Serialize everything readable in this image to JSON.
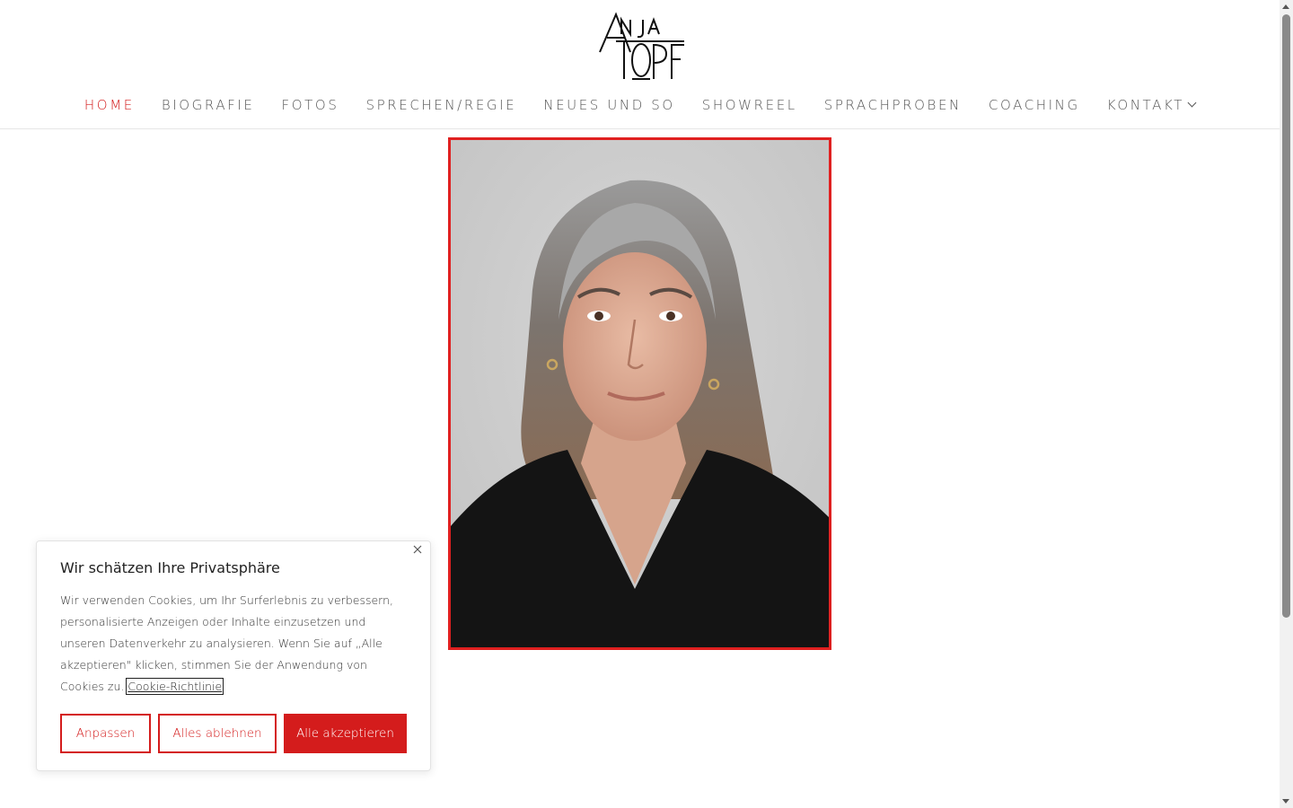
{
  "brand": {
    "logo_text_top": "ANJA",
    "logo_text_bottom": "TOPF",
    "accent_color": "#d41c1c"
  },
  "nav": {
    "items": [
      {
        "label": "HOME",
        "active": true
      },
      {
        "label": "BIOGRAFIE",
        "active": false
      },
      {
        "label": "FOTOS",
        "active": false
      },
      {
        "label": "SPRECHEN/REGIE",
        "active": false
      },
      {
        "label": "NEUES UND SO",
        "active": false
      },
      {
        "label": "SHOWREEL",
        "active": false
      },
      {
        "label": "SPRACHPROBEN",
        "active": false
      },
      {
        "label": "COACHING",
        "active": false
      },
      {
        "label": "KONTAKT",
        "active": false,
        "has_dropdown": true
      }
    ]
  },
  "cookie": {
    "title": "Wir schätzen Ihre Privatsphäre",
    "text": "Wir verwenden Cookies, um Ihr Surferlebnis zu verbessern, personalisierte Anzeigen oder Inhalte einzusetzen und unseren Datenverkehr zu analysieren. Wenn Sie auf „Alle akzeptieren\" klicken, stimmen Sie der Anwendung von Cookies zu.",
    "link_label": "Cookie-Richtlinie",
    "buttons": {
      "customize": "Anpassen",
      "reject": "Alles ablehnen",
      "accept": "Alle akzeptieren"
    },
    "close_icon": "close-icon"
  }
}
